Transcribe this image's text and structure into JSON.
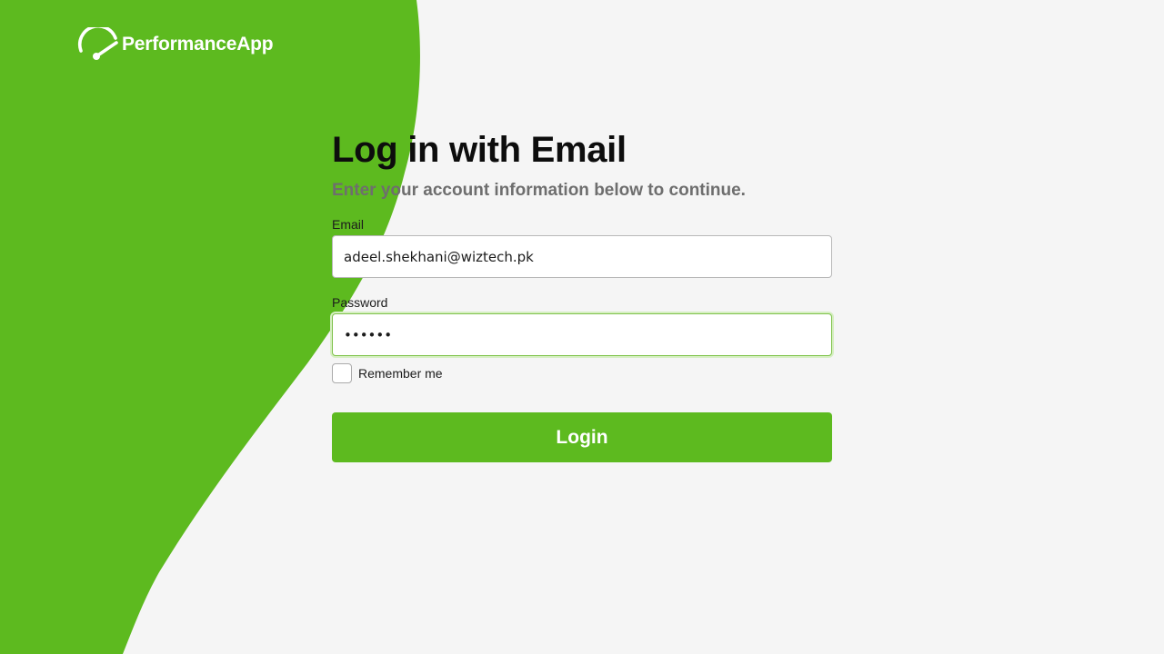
{
  "brand": {
    "name": "PerformanceApp",
    "logo_icon": "speedometer-icon",
    "color": "#5dba1f"
  },
  "form": {
    "title": "Log in with Email",
    "subtitle": "Enter your account information below to continue.",
    "email": {
      "label": "Email",
      "value": "adeel.shekhani@wiztech.pk"
    },
    "password": {
      "label": "Password",
      "value": "••••••",
      "focused": true
    },
    "remember": {
      "label": "Remember me",
      "checked": false
    },
    "submit_label": "Login"
  },
  "colors": {
    "background": "#f5f5f5",
    "accent": "#5dba1f",
    "subtitle": "#6e6e6e",
    "focus_ring": "#7ec24a"
  }
}
